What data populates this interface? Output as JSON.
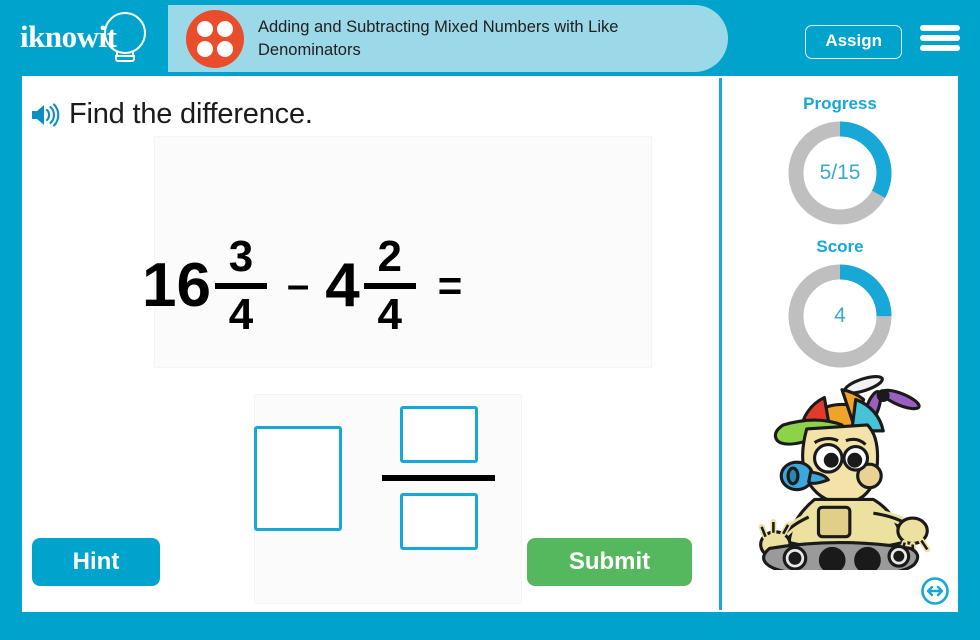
{
  "header": {
    "logo_text": "iknowit",
    "logo_icon": "lightbulb-icon",
    "subject_icon": "four-dots-icon",
    "lesson_title": "Adding and Subtracting Mixed Numbers with Like Denominators",
    "assign_label": "Assign",
    "menu_icon": "hamburger-menu-icon"
  },
  "question": {
    "speaker_icon": "speaker-audio-icon",
    "prompt": "Find the difference.",
    "equation": {
      "left_whole": "16",
      "left_numerator": "3",
      "left_denominator": "4",
      "operator": "–",
      "right_whole": "4",
      "right_numerator": "2",
      "right_denominator": "4",
      "equals": "="
    },
    "answer": {
      "whole_value": "",
      "whole_placeholder": "",
      "numerator_value": "",
      "numerator_placeholder": "",
      "denominator_value": "",
      "denominator_placeholder": ""
    }
  },
  "actions": {
    "hint_label": "Hint",
    "submit_label": "Submit"
  },
  "sidebar": {
    "progress": {
      "label": "Progress",
      "value_text": "5/15",
      "current": 5,
      "total": 15,
      "percent": 33
    },
    "score": {
      "label": "Score",
      "value_text": "4",
      "current": 4,
      "percent": 25
    },
    "mascot_icon": "robot-mascot-propeller-hat",
    "resize_handle_icon": "horizontal-resize-arrows-icon"
  },
  "colors": {
    "frame_blue": "#00a3cc",
    "accent_blue": "#17a8d8",
    "title_strip": "#9bd9e8",
    "submit_green": "#55b75e",
    "subject_orange": "#ea4d2c",
    "ring_track": "#bfbfbf"
  }
}
